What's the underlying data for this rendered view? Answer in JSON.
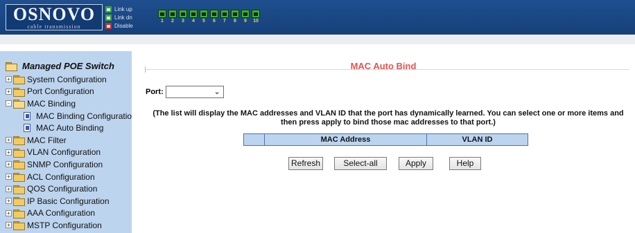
{
  "header": {
    "logo": {
      "main": "OSNOVO",
      "sub": "cable transmission"
    },
    "legend": [
      {
        "label": "Link up",
        "color": "#3aa83a"
      },
      {
        "label": "Link dn",
        "color": "#3aa83a"
      },
      {
        "label": "Disable",
        "color": "#c03030"
      }
    ],
    "ports": [
      "1",
      "2",
      "3",
      "4",
      "5",
      "6",
      "7",
      "8",
      "9",
      "10"
    ],
    "port_color": "#38b428"
  },
  "sidebar": {
    "root_label": "Managed POE Switch",
    "items": [
      {
        "label": "System Configuration",
        "type": "folder",
        "expander": "+",
        "level": 0
      },
      {
        "label": "Port Configuration",
        "type": "folder",
        "expander": "+",
        "level": 0
      },
      {
        "label": "MAC Binding",
        "type": "folder-open",
        "expander": "-",
        "level": 0
      },
      {
        "label": "MAC Binding Configuration",
        "type": "page",
        "level": 1
      },
      {
        "label": "MAC Auto Binding",
        "type": "page",
        "level": 1
      },
      {
        "label": "MAC Filter",
        "type": "folder",
        "expander": "+",
        "level": 0
      },
      {
        "label": "VLAN Configuration",
        "type": "folder",
        "expander": "+",
        "level": 0
      },
      {
        "label": "SNMP Configuration",
        "type": "folder",
        "expander": "+",
        "level": 0
      },
      {
        "label": "ACL Configuration",
        "type": "folder",
        "expander": "+",
        "level": 0
      },
      {
        "label": "QOS Configuration",
        "type": "folder",
        "expander": "+",
        "level": 0
      },
      {
        "label": "IP Basic Configuration",
        "type": "folder",
        "expander": "+",
        "level": 0
      },
      {
        "label": "AAA Configuration",
        "type": "folder",
        "expander": "+",
        "level": 0
      },
      {
        "label": "MSTP Configuration",
        "type": "folder",
        "expander": "+",
        "level": 0
      }
    ]
  },
  "main": {
    "title": "MAC Auto Bind",
    "title_color": "#e0544f",
    "port_label": "Port:",
    "port_value": "",
    "info": "(The list will display the MAC addresses and VLAN ID that the port has dynamically learned. You can select one or more items and then press apply to bind those mac addresses to that port.)",
    "table": {
      "columns": [
        "",
        "MAC Address",
        "VLAN ID"
      ]
    },
    "buttons": {
      "refresh": "Refresh",
      "select_all": "Select-all",
      "apply": "Apply",
      "help": "Help"
    }
  }
}
